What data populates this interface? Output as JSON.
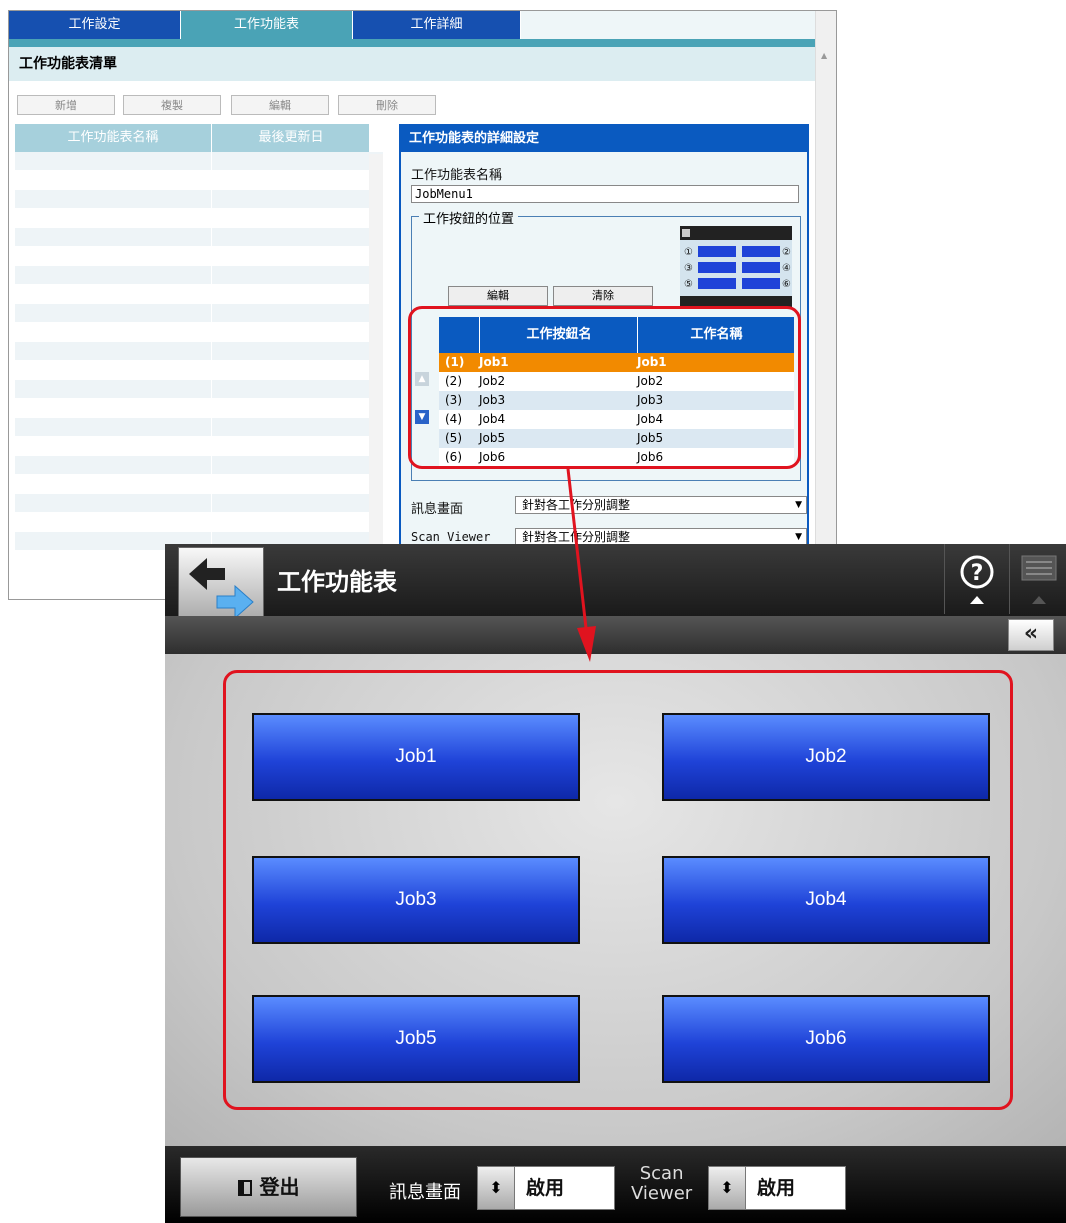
{
  "admin": {
    "tabs": [
      {
        "label": "工作設定",
        "active": false
      },
      {
        "label": "工作功能表",
        "active": true
      },
      {
        "label": "工作詳細",
        "active": false
      }
    ],
    "section_title": "工作功能表清單",
    "toolbar": {
      "add": "新增",
      "copy": "複製",
      "edit": "編輯",
      "delete": "刪除"
    },
    "list": {
      "col_name": "工作功能表名稱",
      "col_updated": "最後更新日"
    },
    "detail": {
      "title": "工作功能表的詳細設定",
      "name_label": "工作功能表名稱",
      "name_value": "JobMenu1",
      "position_legend": "工作按鈕的位置",
      "edit_button": "編輯",
      "clear_button": "清除",
      "mini_labels": [
        "①",
        "②",
        "③",
        "④",
        "⑤",
        "⑥"
      ],
      "table": {
        "col_button": "工作按鈕名",
        "col_job": "工作名稱",
        "rows": [
          {
            "no": "(1)",
            "button": "Job1",
            "job": "Job1",
            "selected": true
          },
          {
            "no": "(2)",
            "button": "Job2",
            "job": "Job2",
            "selected": false
          },
          {
            "no": "(3)",
            "button": "Job3",
            "job": "Job3",
            "selected": false
          },
          {
            "no": "(4)",
            "button": "Job4",
            "job": "Job4",
            "selected": false
          },
          {
            "no": "(5)",
            "button": "Job5",
            "job": "Job5",
            "selected": false
          },
          {
            "no": "(6)",
            "button": "Job6",
            "job": "Job6",
            "selected": false
          }
        ]
      },
      "message_label": "訊息畫面",
      "message_value": "針對各工作分別調整",
      "scanviewer_label": "Scan Viewer",
      "scanviewer_value": "針對各工作分別調整"
    }
  },
  "device": {
    "title": "工作功能表",
    "jobs": [
      "Job1",
      "Job2",
      "Job3",
      "Job4",
      "Job5",
      "Job6"
    ],
    "logout_label": "登出",
    "message_label": "訊息畫面",
    "message_value": "啟用",
    "scanviewer_label_1": "Scan",
    "scanviewer_label_2": "Viewer",
    "scanviewer_value": "啟用",
    "collapse_symbol": "«"
  },
  "colors": {
    "annotation": "#e0131f",
    "tab_active": "#4aa3b6",
    "accent": "#0a5ac0",
    "selected_row": "#f28a00"
  }
}
